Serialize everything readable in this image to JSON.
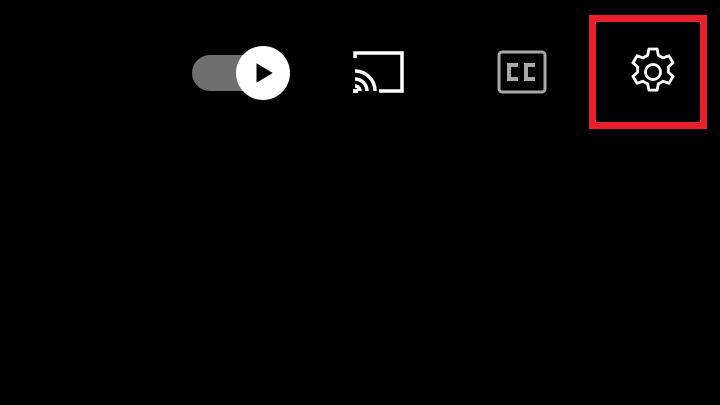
{
  "player_controls": {
    "autoplay": {
      "icon": "play-icon",
      "state": "on"
    },
    "cast": {
      "icon": "cast-icon"
    },
    "captions": {
      "icon": "closed-captions-icon",
      "label": "CC",
      "state": "off"
    },
    "settings": {
      "icon": "gear-icon"
    }
  },
  "colors": {
    "background": "#000000",
    "icon": "#ffffff",
    "toggle_track": "#6e6e6e",
    "captions_disabled": "#a8a8a8",
    "highlight": "#e8202a"
  }
}
